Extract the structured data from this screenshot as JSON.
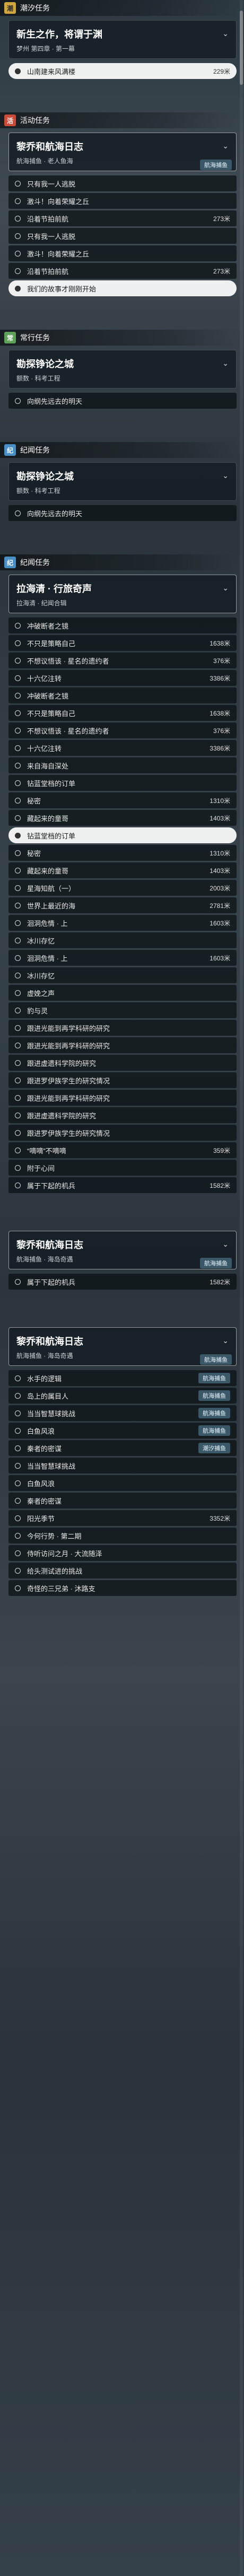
{
  "sections": [
    {
      "header": {
        "tag": "潮",
        "tag_style": "gold",
        "label": "潮汐任务"
      },
      "card": {
        "title": "新生之作，将谓于渊",
        "sub": "梦州 第四章 · 第一幕",
        "badge": "",
        "active": false
      },
      "objectives": [
        {
          "label": "山南建来风满楼",
          "dist": "229米",
          "highlight": true
        }
      ]
    },
    {
      "header": {
        "tag": "活",
        "tag_style": "red",
        "label": "活动任务"
      },
      "card": {
        "title": "黎乔和航海日志",
        "sub": "航海捕鱼 · 老人鱼海",
        "badge": "航海捕鱼",
        "active": true
      },
      "objectives": [
        {
          "label": "只有我一人逃脱",
          "dist": "",
          "highlight": false
        },
        {
          "label": "激斗！向着荣耀之丘",
          "dist": "",
          "highlight": false
        },
        {
          "label": "沿着节拍前航",
          "dist": "273米",
          "highlight": false
        },
        {
          "label": "只有我一人逃脱",
          "dist": "",
          "highlight": false
        },
        {
          "label": "激斗！向着荣耀之丘",
          "dist": "",
          "highlight": false
        },
        {
          "label": "沿着节拍前航",
          "dist": "273米",
          "highlight": false
        },
        {
          "label": "我们的故事才刚刚开始",
          "dist": "",
          "highlight": true
        }
      ]
    },
    {
      "header": {
        "tag": "常",
        "tag_style": "green",
        "label": "常行任务"
      },
      "card": {
        "title": "勘探铮论之城",
        "sub": "额数 · 科考工程",
        "badge": "",
        "active": false
      },
      "objectives": [
        {
          "label": "向纲先远去的明天",
          "dist": "",
          "highlight": false
        }
      ]
    },
    {
      "header": {
        "tag": "纪",
        "tag_style": "blue",
        "label": "纪闻任务"
      },
      "card": {
        "title": "勘探铮论之城",
        "sub": "额数 · 科考工程",
        "badge": "",
        "active": false
      },
      "objectives": [
        {
          "label": "向纲先远去的明天",
          "dist": "",
          "highlight": false
        }
      ]
    },
    {
      "header": {
        "tag": "纪",
        "tag_style": "blue",
        "label": "纪闻任务"
      },
      "card": {
        "title": "拉海清 · 行旅奇声",
        "sub": "拉海清 · 纪闻合辑",
        "badge": "",
        "active": true
      },
      "objectives": [
        {
          "label": "冲破断者之镜",
          "dist": "",
          "highlight": false
        },
        {
          "label": "不只是策略自己",
          "dist": "1638米",
          "highlight": false
        },
        {
          "label": "不想议悟该 · 星名的遗约者",
          "dist": "376米",
          "highlight": false
        },
        {
          "label": "十六亿注转",
          "dist": "3386米",
          "highlight": false
        },
        {
          "label": "冲破断者之镜",
          "dist": "",
          "highlight": false
        },
        {
          "label": "不只是策略自己",
          "dist": "1638米",
          "highlight": false
        },
        {
          "label": "不想议悟该 · 星名的遗约者",
          "dist": "376米",
          "highlight": false
        },
        {
          "label": "十六亿注转",
          "dist": "3386米",
          "highlight": false
        },
        {
          "label": "来自海自深处",
          "dist": "",
          "highlight": false
        },
        {
          "label": "钻蓝堂档的订单",
          "dist": "",
          "highlight": false
        },
        {
          "label": "秘密",
          "dist": "1310米",
          "highlight": false
        },
        {
          "label": "藏起来的童哥",
          "dist": "1403米",
          "highlight": false
        },
        {
          "label": "钻蓝堂档的订单",
          "dist": "",
          "highlight": true
        },
        {
          "label": "秘密",
          "dist": "1310米",
          "highlight": false
        },
        {
          "label": "藏起来的童哥",
          "dist": "1403米",
          "highlight": false
        },
        {
          "label": "星海知航（一）",
          "dist": "2003米",
          "highlight": false
        },
        {
          "label": "世界上最近的海",
          "dist": "2781米",
          "highlight": false
        },
        {
          "label": "洄洞危情 · 上",
          "dist": "1603米",
          "highlight": false
        },
        {
          "label": "冰川存忆",
          "dist": "",
          "highlight": false
        },
        {
          "label": "洄洞危情 · 上",
          "dist": "1603米",
          "highlight": false
        },
        {
          "label": "冰川存忆",
          "dist": "",
          "highlight": false
        },
        {
          "label": "虚娩之声",
          "dist": "",
          "highlight": false
        },
        {
          "label": "豹与灵",
          "dist": "",
          "highlight": false
        },
        {
          "label": "跟进光能到再学科研的研究",
          "dist": "",
          "highlight": false
        },
        {
          "label": "跟进光能到再学科研的研究",
          "dist": "",
          "highlight": false
        },
        {
          "label": "跟进虚遗科学院的研究",
          "dist": "",
          "highlight": false
        },
        {
          "label": "跟进罗伊族学生的研究情况",
          "dist": "",
          "highlight": false
        },
        {
          "label": "跟进光能到再学科研的研究",
          "dist": "",
          "highlight": false
        },
        {
          "label": "跟进虚遗科学院的研究",
          "dist": "",
          "highlight": false
        },
        {
          "label": "跟进罗伊族学生的研究情况",
          "dist": "",
          "highlight": false
        },
        {
          "label": "“嘀嘀”不嘀嘀",
          "dist": "359米",
          "highlight": false
        },
        {
          "label": "附于心间",
          "dist": "",
          "highlight": false
        },
        {
          "label": "属于下起的机兵",
          "dist": "1582米",
          "highlight": false
        }
      ]
    },
    {
      "header": {
        "tag": "",
        "tag_style": "blue",
        "label": ""
      },
      "card": {
        "title": "黎乔和航海日志",
        "sub": "航海捕鱼 · 海岛奇遇",
        "badge": "航海捕鱼",
        "active": true
      },
      "objectives": [
        {
          "label": "属于下起的机兵",
          "dist": "1582米",
          "highlight": false
        }
      ]
    },
    {
      "header": {
        "tag": "",
        "tag_style": "blue",
        "label": ""
      },
      "card": {
        "title": "黎乔和航海日志",
        "sub": "航海捕鱼 · 海岛奇遇",
        "badge": "航海捕鱼",
        "active": true
      },
      "objectives": [
        {
          "label": "水手的逻辑",
          "dist": "",
          "highlight": false,
          "badge": "航海捕鱼"
        },
        {
          "label": "岛上的属目人",
          "dist": "",
          "highlight": false,
          "badge": "航海捕鱼"
        },
        {
          "label": "当当智慧球挑战",
          "dist": "",
          "highlight": false,
          "badge": "航海捕鱼"
        },
        {
          "label": "白鱼风浪",
          "dist": "",
          "highlight": false,
          "badge": "航海捕鱼"
        },
        {
          "label": "秦者的密谋",
          "dist": "",
          "highlight": false,
          "badge": "潮汐捕鱼"
        },
        {
          "label": "当当智慧球挑战",
          "dist": "",
          "highlight": false
        },
        {
          "label": "白鱼风浪",
          "dist": "",
          "highlight": false
        },
        {
          "label": "秦者的密谋",
          "dist": "",
          "highlight": false
        },
        {
          "label": "阳光季节",
          "dist": "3352米",
          "highlight": false
        },
        {
          "label": "今何行势 · 第二期",
          "dist": "",
          "highlight": false
        },
        {
          "label": "侍听访问之月 · 大流随泽",
          "dist": "",
          "highlight": false
        },
        {
          "label": "给头测试进的挑战",
          "dist": "",
          "highlight": false
        },
        {
          "label": "奇怪的三兄弟 · 沐路支",
          "dist": "",
          "highlight": false
        }
      ]
    }
  ]
}
